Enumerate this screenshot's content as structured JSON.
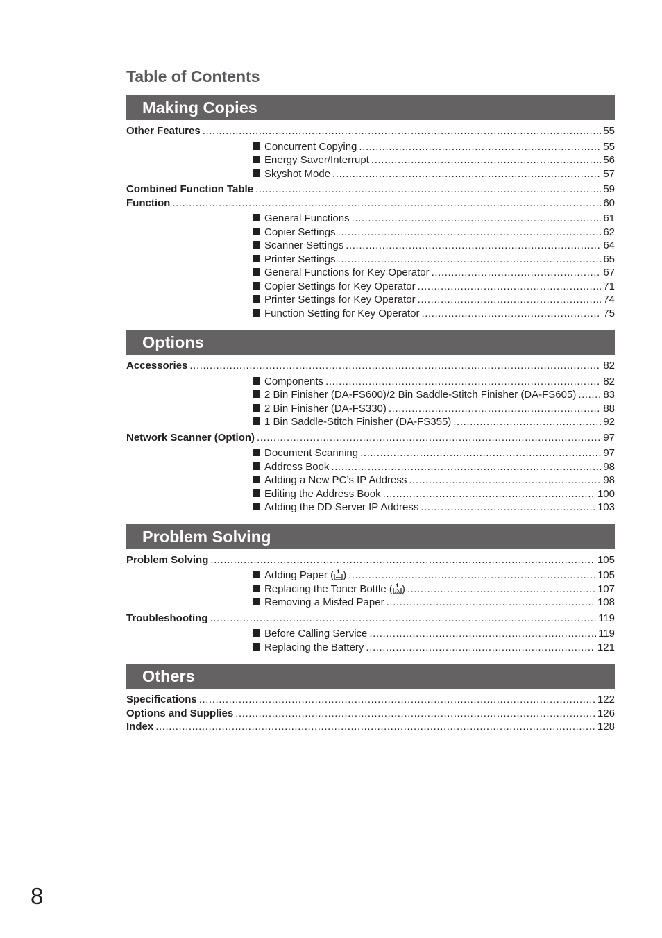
{
  "title": "Table of Contents",
  "page_number": "8",
  "colors": {
    "bar": "#646263",
    "title": "#58595b",
    "text": "#231f20"
  },
  "sections": [
    {
      "heading": "Making Copies",
      "entries": [
        {
          "type": "main",
          "label": "Other Features",
          "page": "55"
        },
        {
          "type": "sub",
          "label": "Concurrent Copying",
          "page": "55"
        },
        {
          "type": "sub",
          "label": "Energy Saver/Interrupt",
          "page": "56"
        },
        {
          "type": "sub",
          "label": "Skyshot Mode",
          "page": "57"
        },
        {
          "type": "main",
          "label": "Combined Function Table",
          "page": "59"
        },
        {
          "type": "main",
          "label": "Function",
          "page": "60",
          "tight": true
        },
        {
          "type": "sub",
          "label": "General Functions",
          "page": "61"
        },
        {
          "type": "sub",
          "label": "Copier Settings",
          "page": "62"
        },
        {
          "type": "sub",
          "label": "Scanner Settings",
          "page": "64"
        },
        {
          "type": "sub",
          "label": "Printer Settings",
          "page": "65"
        },
        {
          "type": "sub",
          "label": "General Functions for Key Operator",
          "page": "67"
        },
        {
          "type": "sub",
          "label": "Copier Settings for Key Operator",
          "page": "71"
        },
        {
          "type": "sub",
          "label": "Printer Settings for Key Operator",
          "page": "74"
        },
        {
          "type": "sub",
          "label": "Function Setting for Key Operator",
          "page": "75"
        }
      ]
    },
    {
      "heading": "Options",
      "entries": [
        {
          "type": "main",
          "label": "Accessories",
          "page": "82"
        },
        {
          "type": "sub",
          "label": "Components",
          "page": "82"
        },
        {
          "type": "sub",
          "label": "2 Bin Finisher (DA-FS600)/2 Bin Saddle-Stitch Finisher (DA-FS605)",
          "page": "83"
        },
        {
          "type": "sub",
          "label": "2 Bin Finisher (DA-FS330)",
          "page": "88"
        },
        {
          "type": "sub",
          "label": "1 Bin Saddle-Stitch Finisher (DA-FS355)",
          "page": "92"
        },
        {
          "type": "main",
          "label": "Network Scanner (Option)",
          "page": "97"
        },
        {
          "type": "sub",
          "label": "Document Scanning",
          "page": "97"
        },
        {
          "type": "sub",
          "label": "Address Book",
          "page": "98"
        },
        {
          "type": "sub",
          "label": "Adding a New PC’s IP Address",
          "page": "98"
        },
        {
          "type": "sub",
          "label": "Editing the Address Book",
          "page": "100"
        },
        {
          "type": "sub",
          "label": "Adding the DD Server IP Address",
          "page": "103"
        }
      ]
    },
    {
      "heading": "Problem Solving",
      "entries": [
        {
          "type": "main",
          "label": "Problem Solving",
          "page": "105"
        },
        {
          "type": "sub",
          "label": "Adding Paper",
          "icon": "paper-tray-icon",
          "page": "105"
        },
        {
          "type": "sub",
          "label": "Replacing the Toner Bottle",
          "icon": "toner-bottle-icon",
          "page": "107"
        },
        {
          "type": "sub",
          "label": "Removing a Misfed Paper",
          "page": "108"
        },
        {
          "type": "main",
          "label": "Troubleshooting",
          "page": "119"
        },
        {
          "type": "sub",
          "label": "Before Calling Service",
          "page": "119"
        },
        {
          "type": "sub",
          "label": "Replacing the Battery",
          "page": "121"
        }
      ]
    },
    {
      "heading": "Others",
      "entries": [
        {
          "type": "main",
          "label": "Specifications",
          "page": "122"
        },
        {
          "type": "main",
          "label": "Options and Supplies",
          "page": "126"
        },
        {
          "type": "main",
          "label": "Index",
          "page": "128"
        }
      ]
    }
  ]
}
